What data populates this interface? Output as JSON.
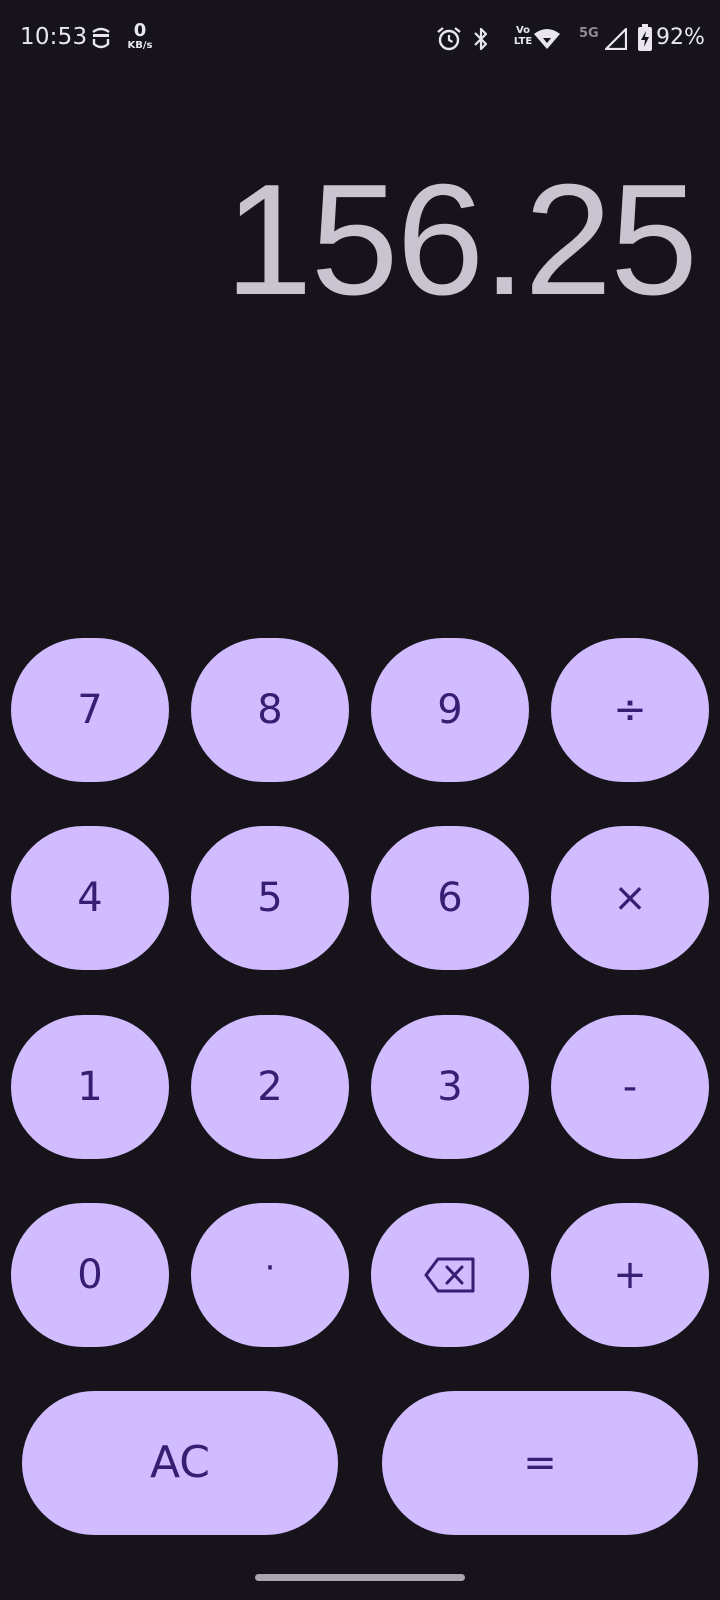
{
  "status_bar": {
    "time": "10:53",
    "net_speed_value": "0",
    "net_speed_unit": "KB/s",
    "volte_top": "Vo",
    "volte_bottom": "LTE",
    "network_type": "5G",
    "battery_percent": "92%"
  },
  "display": {
    "value": "156.25"
  },
  "keypad": {
    "row1": [
      "7",
      "8",
      "9",
      "÷"
    ],
    "row2": [
      "4",
      "5",
      "6",
      "×"
    ],
    "row3": [
      "1",
      "2",
      "3",
      "-"
    ],
    "row4": [
      "0",
      "·",
      "backspace-icon",
      "+"
    ],
    "ac_label": "AC",
    "equals_label": "="
  },
  "colors": {
    "background": "#16131b",
    "key_fill": "#d0bcff",
    "key_text": "#381e72",
    "display_text": "#cac4d0"
  }
}
